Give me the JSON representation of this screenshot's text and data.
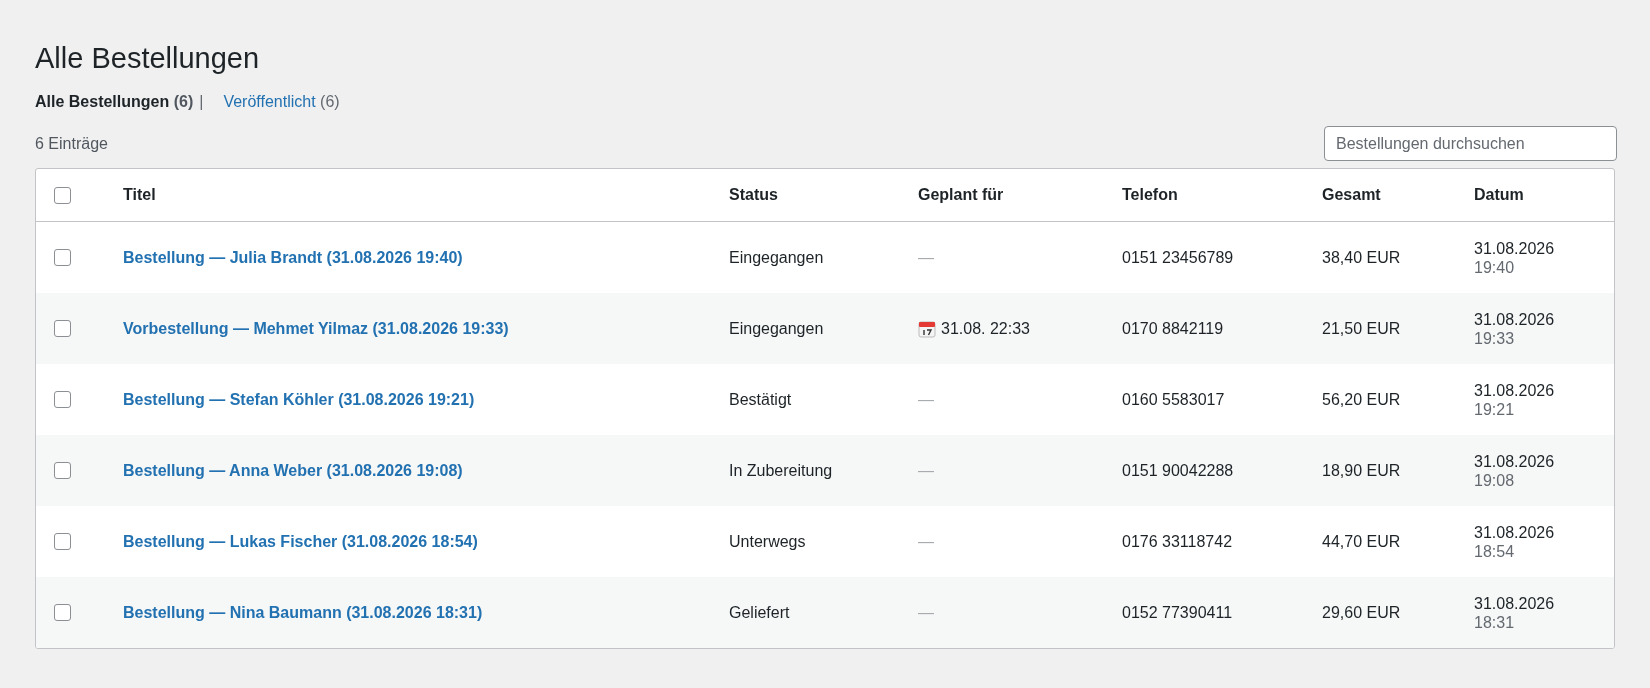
{
  "page_title": "Alle Bestellungen",
  "views": [
    {
      "label": "Alle Bestellungen",
      "count": "(6)",
      "selected": true,
      "separator": "|"
    },
    {
      "label": "Veröffentlicht",
      "count": "(6)",
      "selected": false
    }
  ],
  "entries_count": "6 Einträge",
  "search": {
    "placeholder": "Bestellungen durchsuchen"
  },
  "table": {
    "select_all": {
      "checked": false
    },
    "columns": [
      "Titel",
      "Status",
      "Geplant für",
      "Telefon",
      "Gesamt",
      "Datum"
    ],
    "rows": [
      {
        "checked": false,
        "title": "Bestellung — Julia Brandt (31.08.2026 19:40)",
        "status": "Eingegangen",
        "scheduled": "—",
        "scheduled_icon": false,
        "phone": "0151 23456789",
        "total": "38,40 EUR",
        "date": "31.08.2026",
        "time": "19:40"
      },
      {
        "checked": false,
        "title": "Vorbestellung — Mehmet Yilmaz (31.08.2026 19:33)",
        "status": "Eingegangen",
        "scheduled": "31.08. 22:33",
        "scheduled_icon": true,
        "phone": "0170 8842119",
        "total": "21,50 EUR",
        "date": "31.08.2026",
        "time": "19:33"
      },
      {
        "checked": false,
        "title": "Bestellung — Stefan Köhler (31.08.2026 19:21)",
        "status": "Bestätigt",
        "scheduled": "—",
        "scheduled_icon": false,
        "phone": "0160 5583017",
        "total": "56,20 EUR",
        "date": "31.08.2026",
        "time": "19:21"
      },
      {
        "checked": false,
        "title": "Bestellung — Anna Weber (31.08.2026 19:08)",
        "status": "In Zubereitung",
        "scheduled": "—",
        "scheduled_icon": false,
        "phone": "0151 90042288",
        "total": "18,90 EUR",
        "date": "31.08.2026",
        "time": "19:08"
      },
      {
        "checked": false,
        "title": "Bestellung — Lukas Fischer (31.08.2026 18:54)",
        "status": "Unterwegs",
        "scheduled": "—",
        "scheduled_icon": false,
        "phone": "0176 33118742",
        "total": "44,70 EUR",
        "date": "31.08.2026",
        "time": "18:54"
      },
      {
        "checked": false,
        "title": "Bestellung — Nina Baumann (31.08.2026 18:31)",
        "status": "Geliefert",
        "scheduled": "—",
        "scheduled_icon": false,
        "phone": "0152 77390411",
        "total": "29,60 EUR",
        "date": "31.08.2026",
        "time": "18:31"
      }
    ]
  }
}
